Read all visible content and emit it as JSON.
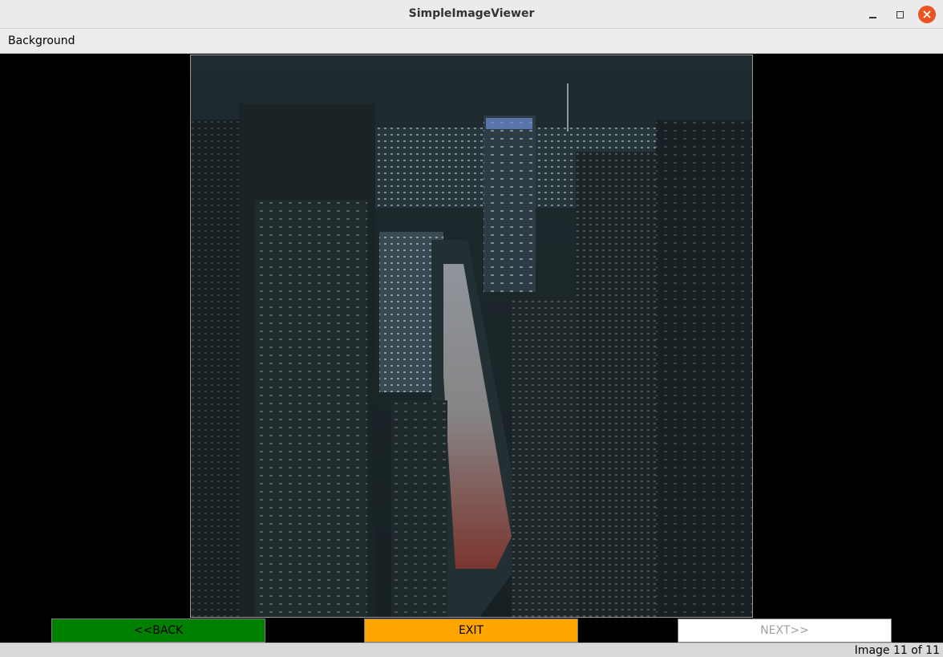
{
  "window": {
    "title": "SimpleImageViewer",
    "close_icon": "close-icon",
    "minimize_icon": "minimize-icon",
    "maximize_icon": "maximize-icon"
  },
  "menu": {
    "items": [
      "Background"
    ]
  },
  "viewer": {
    "image_subject": "night-city-aerial-photo"
  },
  "buttons": {
    "back_label": "<<BACK",
    "exit_label": "EXIT",
    "next_label": "NEXT>>",
    "back_color": "#008000",
    "exit_color": "#ffa500",
    "next_color": "#ffffff"
  },
  "status": {
    "text": "Image 11 of 11"
  }
}
